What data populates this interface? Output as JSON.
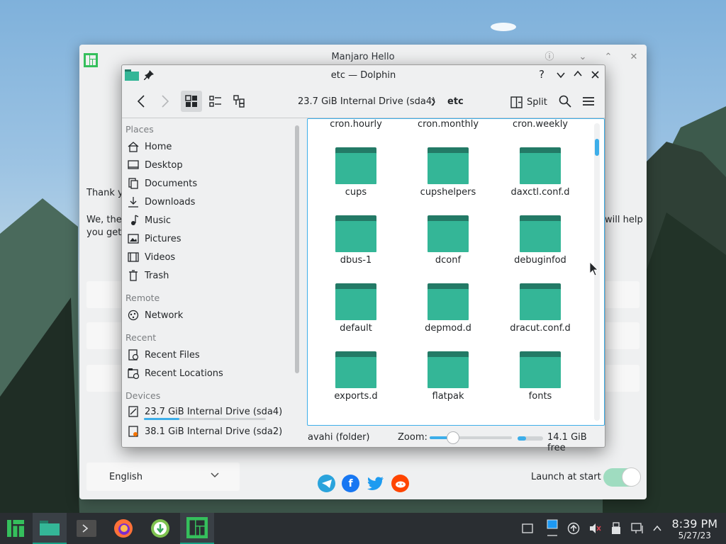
{
  "hello": {
    "title": "Manjaro Hello",
    "thank_text": "Thank y",
    "we_text": "We, the",
    "you_get_text": "you get",
    "will_help_text": "will help",
    "language": "English",
    "launch_label": "Launch at start",
    "launch_at_start": true,
    "social_icons": [
      "telegram-icon",
      "facebook-icon",
      "twitter-icon",
      "reddit-icon"
    ]
  },
  "dolphin": {
    "title": "etc — Dolphin",
    "breadcrumb": {
      "drive": "23.7 GiB Internal Drive (sda4)",
      "current": "etc"
    },
    "split_label": "Split",
    "places": {
      "places_header": "Places",
      "places_items": [
        "Home",
        "Desktop",
        "Documents",
        "Downloads",
        "Music",
        "Pictures",
        "Videos",
        "Trash"
      ],
      "remote_header": "Remote",
      "remote_items": [
        "Network"
      ],
      "recent_header": "Recent",
      "recent_items": [
        "Recent Files",
        "Recent Locations"
      ],
      "devices_header": "Devices",
      "devices_items": [
        "23.7 GiB Internal Drive (sda4)",
        "38.1 GiB Internal Drive (sda2)"
      ]
    },
    "folders": [
      "cron.hourly",
      "cron.monthly",
      "cron.weekly",
      "cups",
      "cupshelpers",
      "daxctl.conf.d",
      "dbus-1",
      "dconf",
      "debuginfod",
      "default",
      "depmod.d",
      "dracut.conf.d",
      "exports.d",
      "flatpak",
      "fonts"
    ],
    "status": {
      "selection": "avahi (folder)",
      "zoom_label": "Zoom:",
      "free_space": "14.1 GiB free"
    }
  },
  "taskbar": {
    "time": "8:39 PM",
    "date": "5/27/23"
  },
  "colors": {
    "accent": "#3daee9",
    "folder": "#34b697",
    "folder_tab": "#237a66",
    "manjaro_green": "#35bf5c"
  }
}
